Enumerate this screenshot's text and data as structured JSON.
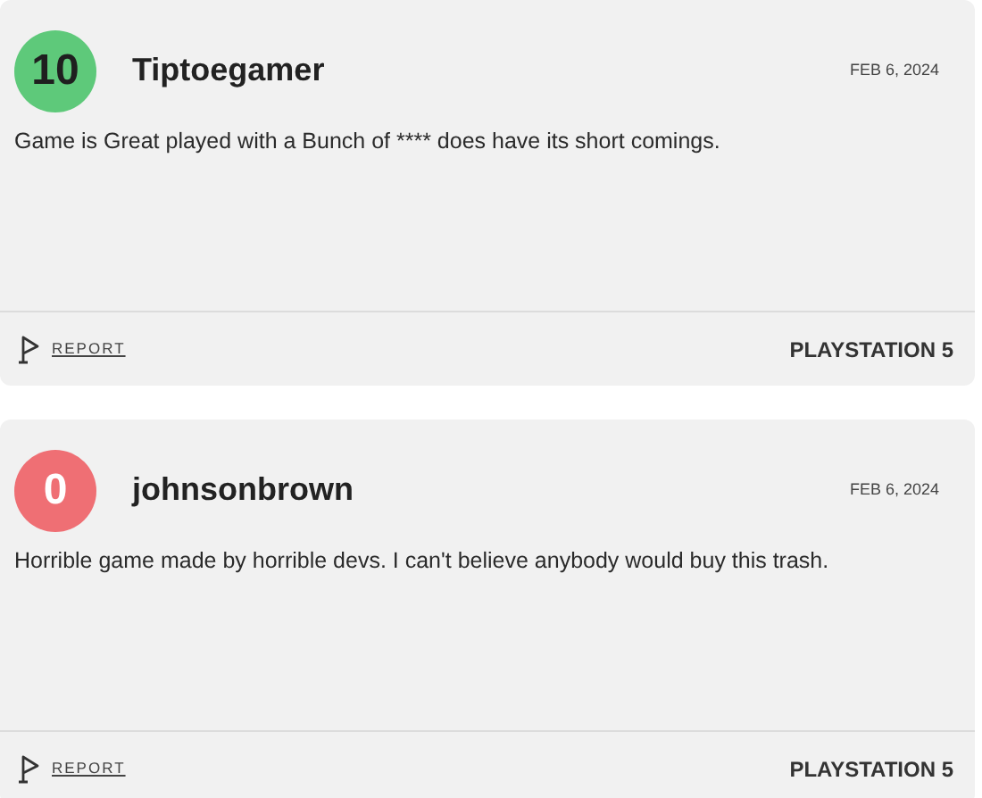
{
  "reviews": [
    {
      "score": "10",
      "kind": "positive",
      "color": "#5ec97a",
      "author": "Tiptoegamer",
      "date": "FEB 6, 2024",
      "body": "Game is Great played with a Bunch of **** does have its short comings.",
      "report": "REPORT",
      "platform": "PLAYSTATION 5"
    },
    {
      "score": "0",
      "kind": "negative",
      "color": "#ef6f74",
      "author": "johnsonbrown",
      "date": "FEB 6, 2024",
      "body": "Horrible game made by horrible devs. I can't believe anybody would buy this trash.",
      "report": "REPORT",
      "platform": "PLAYSTATION 5"
    }
  ]
}
